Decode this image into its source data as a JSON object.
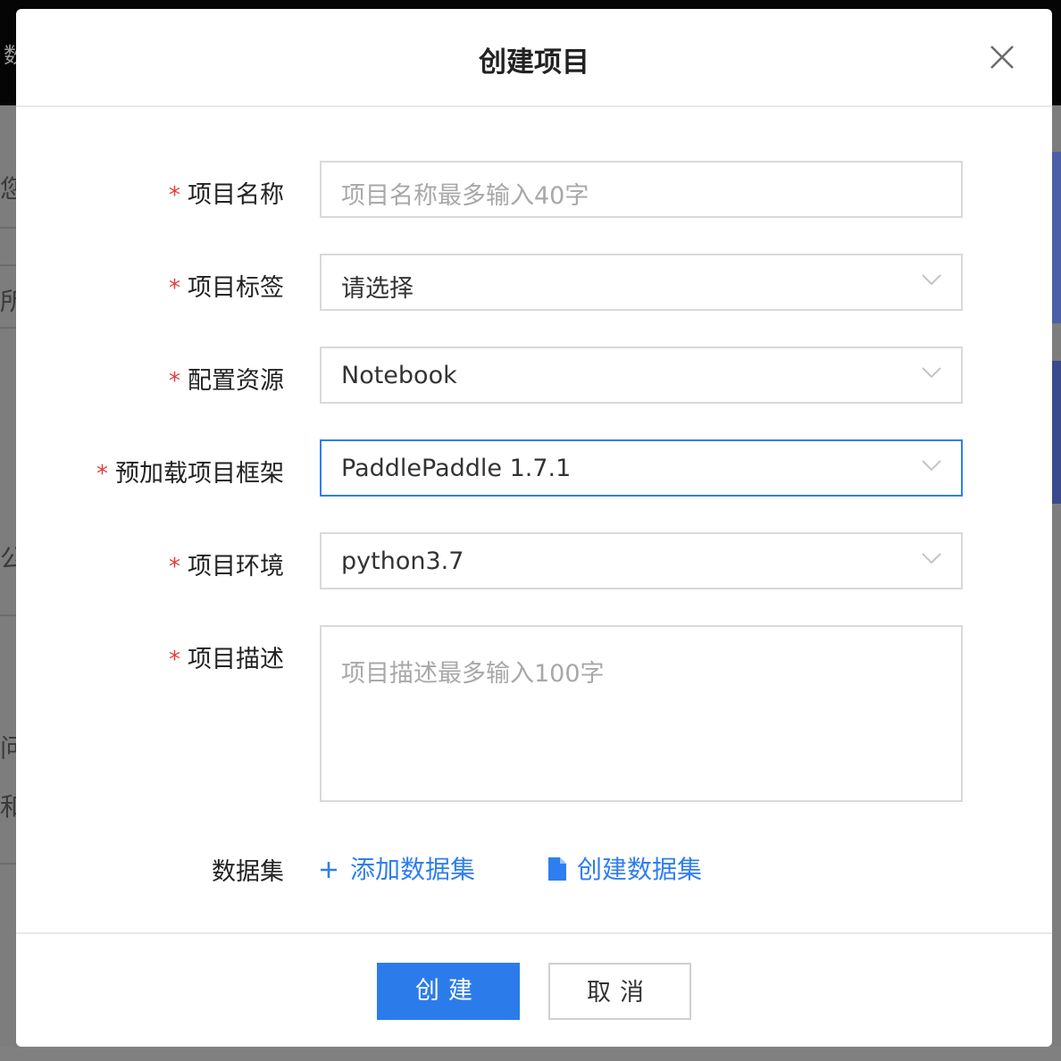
{
  "background": {
    "topbar_fragment": "数",
    "left_fragments": [
      "您的",
      "所",
      "公开",
      "问题",
      "和"
    ]
  },
  "dialog": {
    "title": "创建项目",
    "close_icon": "close-icon",
    "required_mark": "*"
  },
  "form": {
    "project_name": {
      "label": "项目名称",
      "placeholder": "项目名称最多输入40字",
      "value": ""
    },
    "project_tags": {
      "label": "项目标签",
      "value": "请选择"
    },
    "resource": {
      "label": "配置资源",
      "value": "Notebook"
    },
    "framework": {
      "label": "预加载项目框架",
      "value": "PaddlePaddle 1.7.1"
    },
    "environment": {
      "label": "项目环境",
      "value": "python3.7"
    },
    "description": {
      "label": "项目描述",
      "placeholder": "项目描述最多输入100字",
      "value": ""
    },
    "dataset": {
      "label": "数据集",
      "add_label": "添加数据集",
      "create_label": "创建数据集"
    }
  },
  "footer": {
    "create_label": "创建",
    "cancel_label": "取消"
  },
  "colors": {
    "accent": "#2b7cea",
    "required": "#e23c3c",
    "border": "#d9d9d9",
    "focus_border": "#2f7ef0"
  }
}
